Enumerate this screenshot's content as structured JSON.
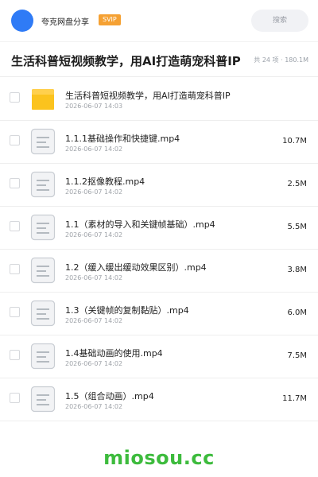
{
  "header": {
    "share_name": "夸克网盘分享",
    "badge": "SVIP",
    "search_placeholder": "搜索",
    "accent": "#2f7bf6",
    "badge_color": "#f5a133"
  },
  "folder": {
    "title": "生活科普短视频教学，用AI打造萌宠科普IP",
    "meta": "共 24 项 · 180.1M"
  },
  "files": [
    {
      "type": "folder",
      "icon": "folder-icon",
      "name": "生活科普短视频教学，用AI打造萌宠科普IP",
      "date": "2026-06-07 14:03",
      "size": ""
    },
    {
      "type": "file",
      "icon": "file-icon",
      "name": "1.1.1基础操作和快捷键.mp4",
      "date": "2026-06-07 14:02",
      "size": "10.7M"
    },
    {
      "type": "file",
      "icon": "file-icon",
      "name": "1.1.2抠像教程.mp4",
      "date": "2026-06-07 14:02",
      "size": "2.5M"
    },
    {
      "type": "file",
      "icon": "file-icon",
      "name": "1.1（素材的导入和关键帧基础）.mp4",
      "date": "2026-06-07 14:02",
      "size": "5.5M"
    },
    {
      "type": "file",
      "icon": "file-icon",
      "name": "1.2（缓入缓出缓动效果区别）.mp4",
      "date": "2026-06-07 14:02",
      "size": "3.8M"
    },
    {
      "type": "file",
      "icon": "file-icon",
      "name": "1.3（关键帧的复制黏贴）.mp4",
      "date": "2026-06-07 14:02",
      "size": "6.0M"
    },
    {
      "type": "file",
      "icon": "file-icon",
      "name": "1.4基础动画的使用.mp4",
      "date": "2026-06-07 14:02",
      "size": "7.5M"
    },
    {
      "type": "file",
      "icon": "file-icon",
      "name": "1.5（组合动画）.mp4",
      "date": "2026-06-07 14:02",
      "size": "11.7M"
    }
  ],
  "watermark": "miosou.cc"
}
